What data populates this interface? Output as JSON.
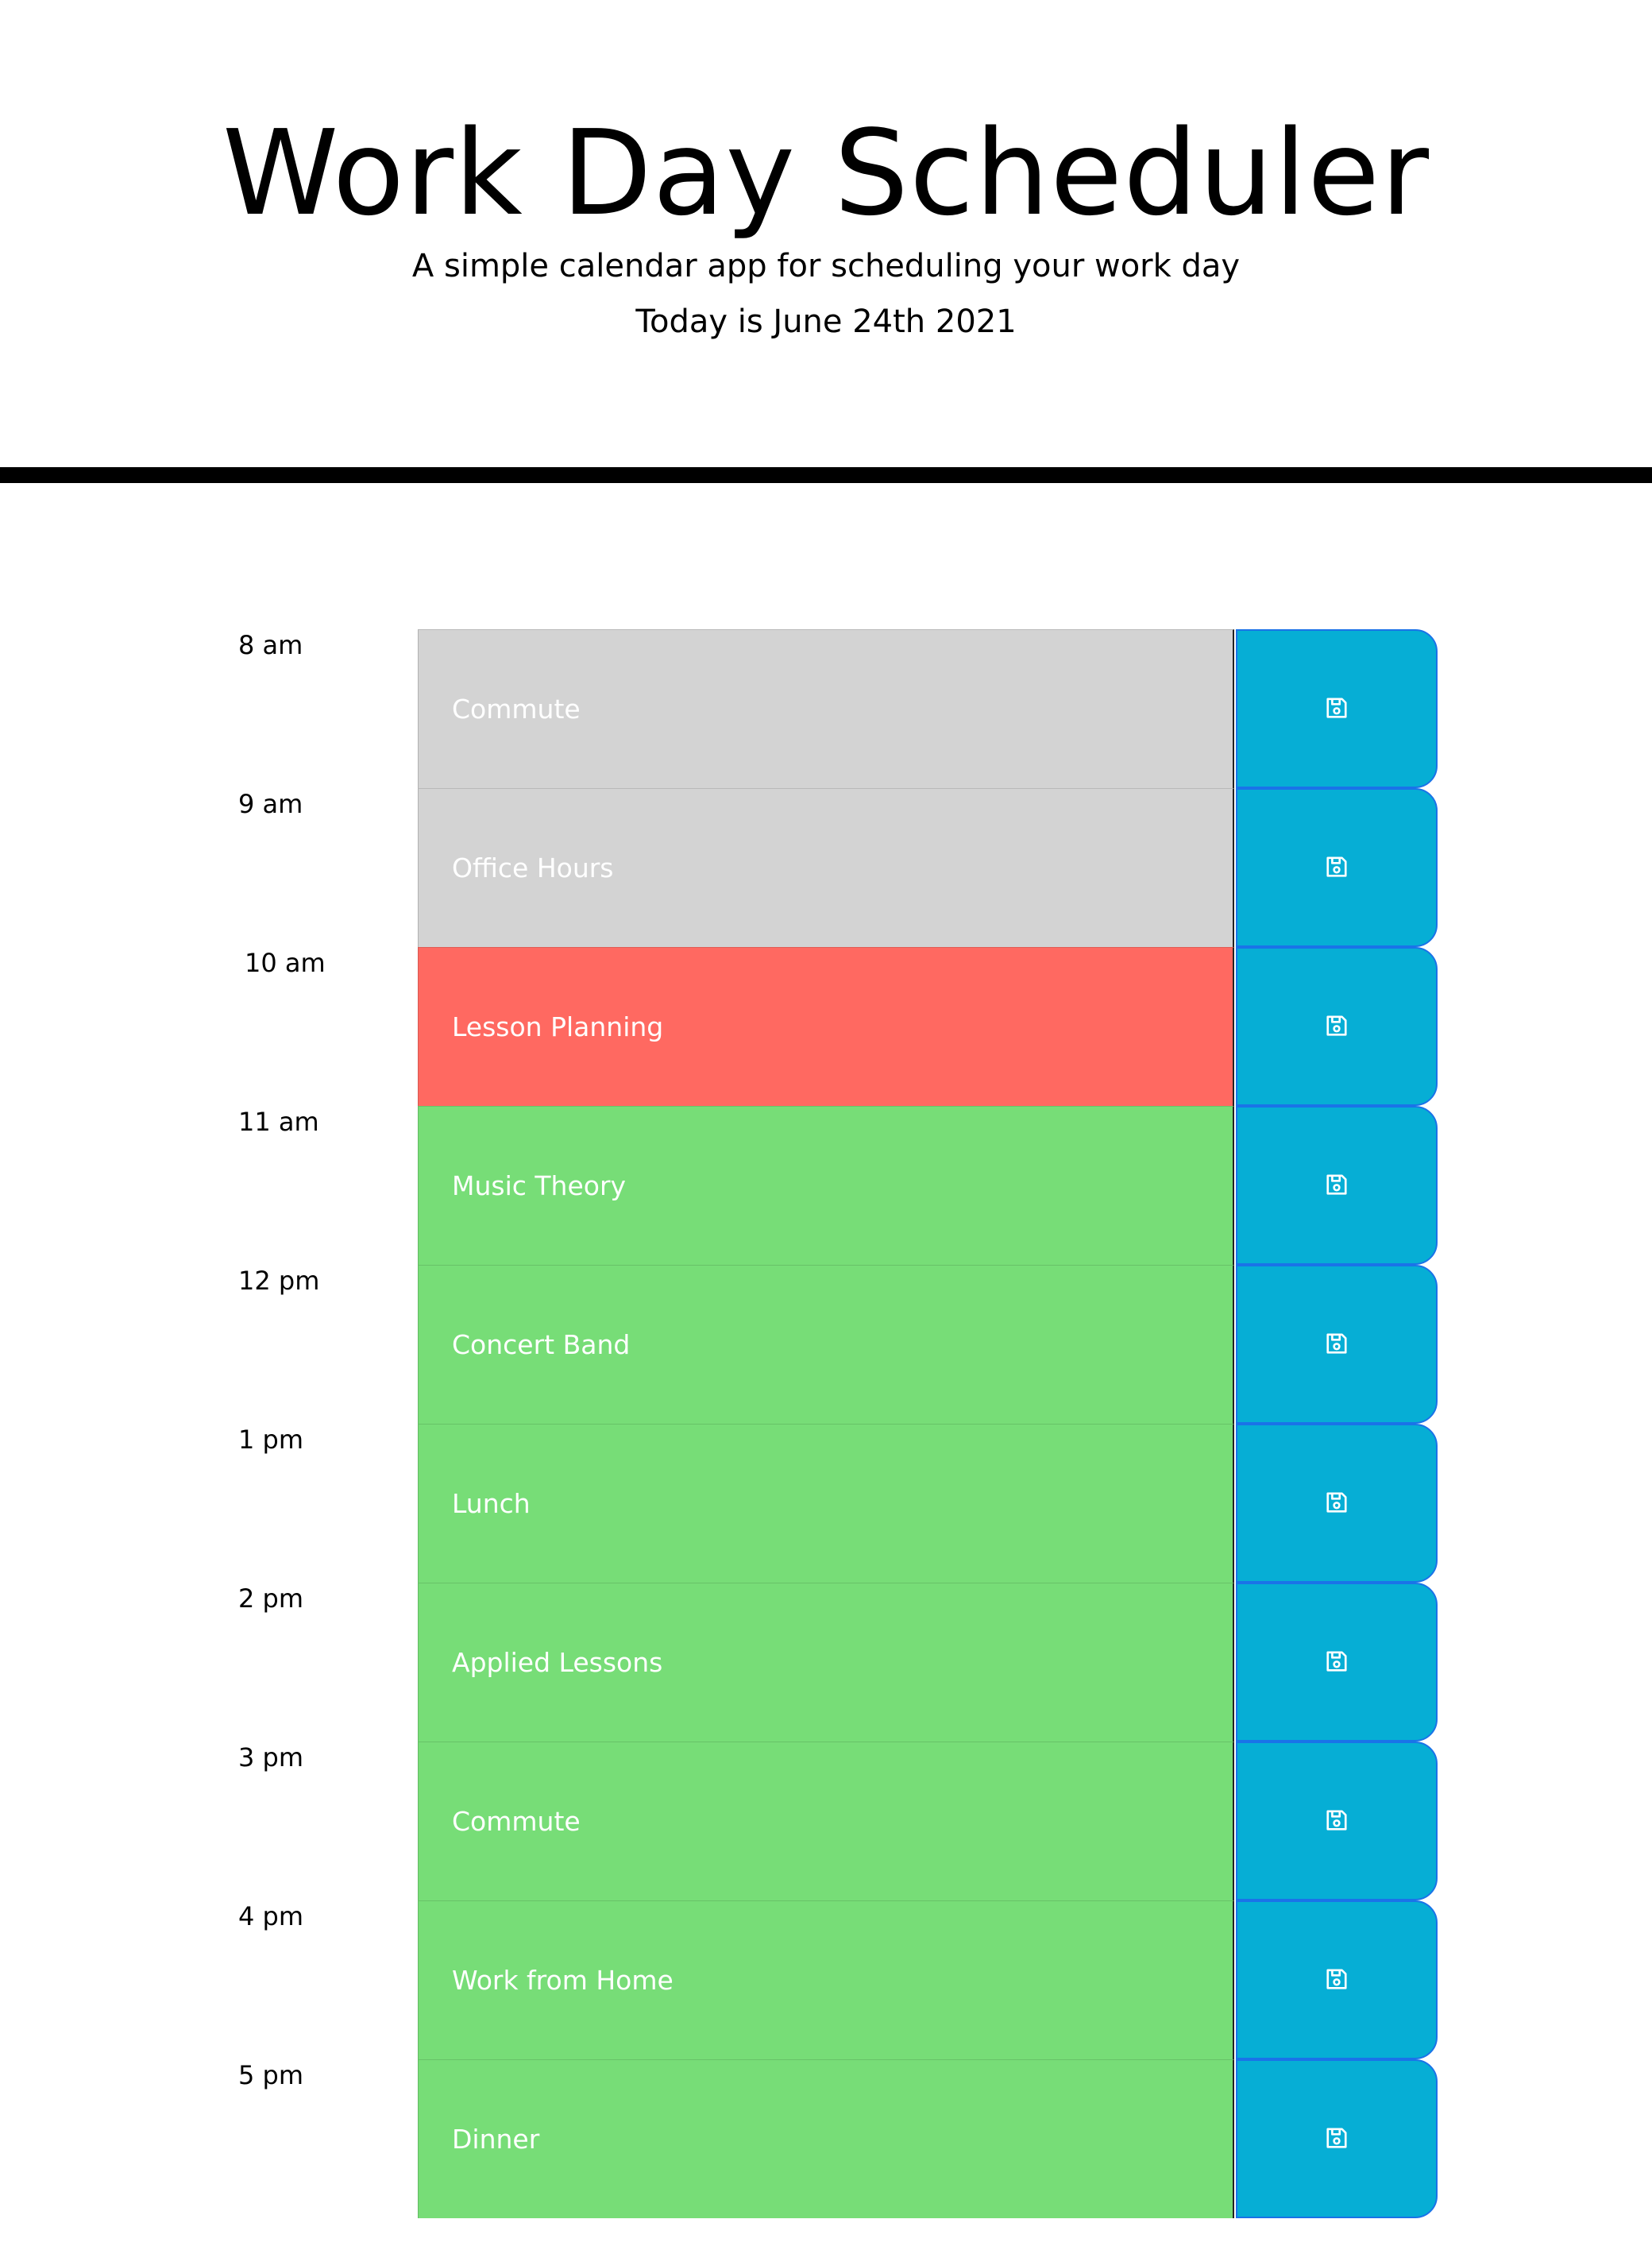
{
  "header": {
    "title": "Work Day Scheduler",
    "subtitle": "A simple calendar app for scheduling your work day",
    "current_day": "Today is June 24th 2021"
  },
  "colors": {
    "past": "#d3d3d3",
    "present": "#ff6961",
    "future": "#77dd77",
    "save_button": "#06aed5"
  },
  "timeblocks": [
    {
      "hour": "8 am",
      "event": "Commute",
      "status": "past",
      "icon": "save-icon"
    },
    {
      "hour": "9 am",
      "event": "Office Hours",
      "status": "past",
      "icon": "save-icon"
    },
    {
      "hour": "10 am",
      "event": "Lesson Planning",
      "status": "present",
      "icon": "save-icon"
    },
    {
      "hour": "11 am",
      "event": "Music Theory",
      "status": "future",
      "icon": "save-icon"
    },
    {
      "hour": "12 pm",
      "event": "Concert Band",
      "status": "future",
      "icon": "save-icon"
    },
    {
      "hour": "1 pm",
      "event": "Lunch",
      "status": "future",
      "icon": "save-icon"
    },
    {
      "hour": "2 pm",
      "event": "Applied Lessons",
      "status": "future",
      "icon": "save-icon"
    },
    {
      "hour": "3 pm",
      "event": "Commute",
      "status": "future",
      "icon": "save-icon"
    },
    {
      "hour": "4 pm",
      "event": "Work from Home",
      "status": "future",
      "icon": "save-icon"
    },
    {
      "hour": "5 pm",
      "event": "Dinner",
      "status": "future",
      "icon": "save-icon"
    }
  ]
}
